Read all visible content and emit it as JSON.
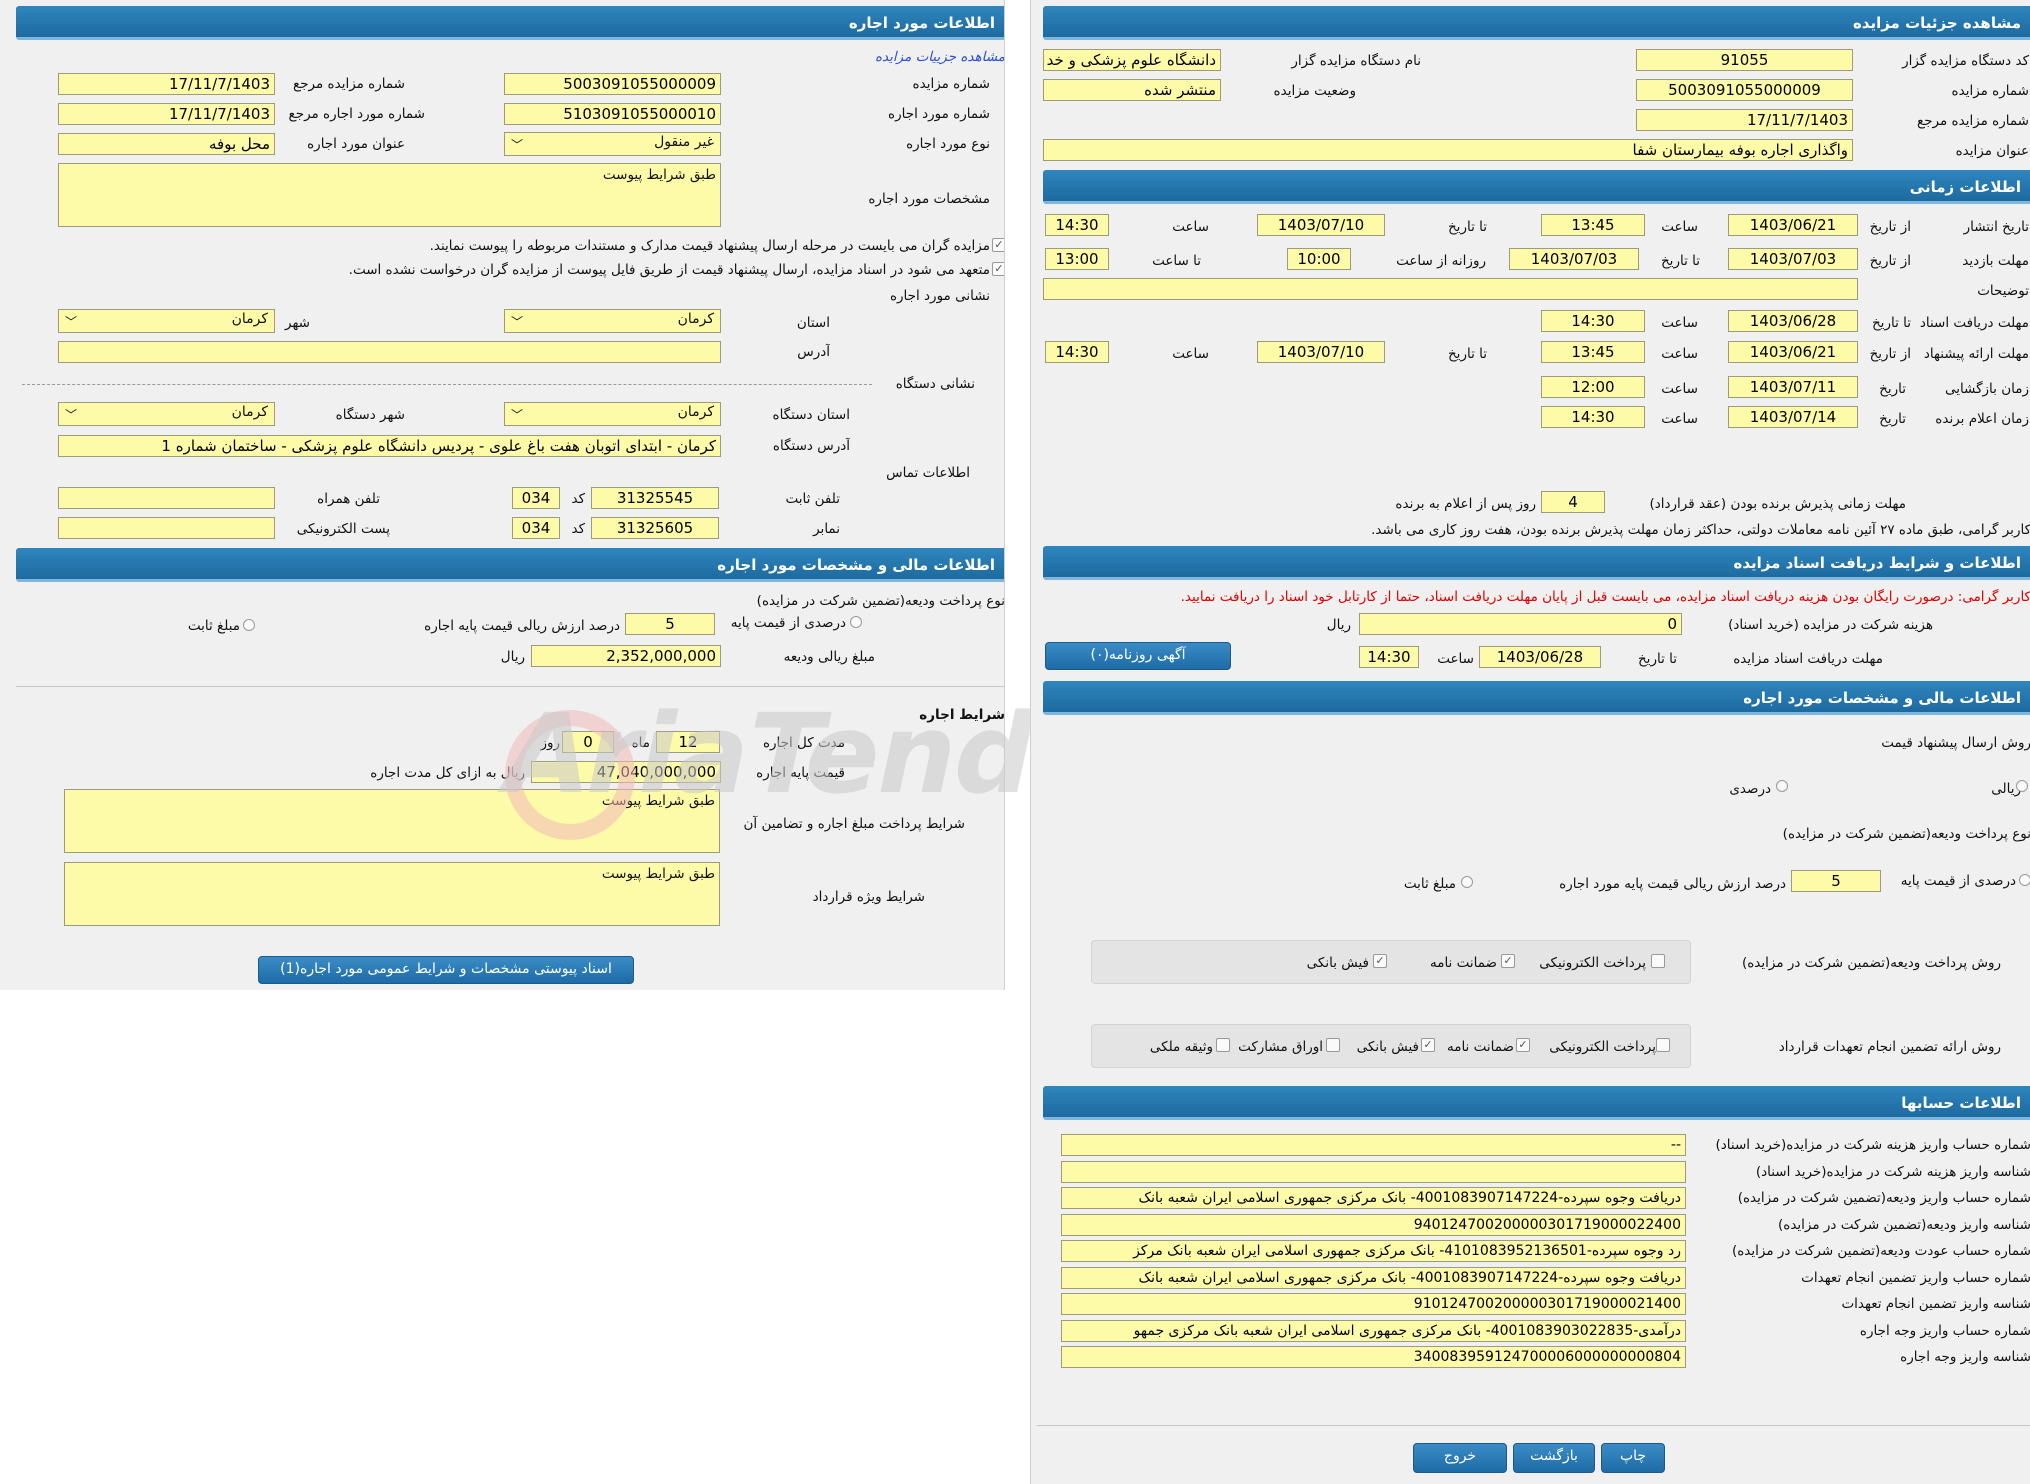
{
  "left": {
    "header": "اطلاعات مورد اجاره",
    "view_link": "مشاهده جزییات مزایده",
    "f": {
      "auction_no": "شماره مزایده",
      "auction_no_v": "5003091055000009",
      "ref_no": "شماره مزایده مرجع",
      "ref_no_v": "17/11/7/1403",
      "item_no": "شماره مورد اجاره",
      "item_no_v": "5103091055000010",
      "item_ref": "شماره مورد اجاره مرجع",
      "item_ref_v": "17/11/7/1403",
      "type": "نوع مورد اجاره",
      "type_v": "غیر منقول",
      "title": "عنوان مورد اجاره",
      "title_v": "محل بوفه",
      "spec": "مشخصات مورد اجاره",
      "spec_v": "طبق شرایط پیوست"
    },
    "chk1": "مزایده گران می بایست در مرحله ارسال پیشنهاد قیمت مدارک و مستندات مربوطه را پیوست نمایند.",
    "chk2": "متعهد می شود در اسناد مزایده، ارسال پیشنهاد قیمت از طریق فایل پیوست از مزایده گران درخواست نشده است.",
    "addr_sec": "نشانی مورد اجاره",
    "province": "استان",
    "province_v": "کرمان",
    "city": "شهر",
    "city_v": "کرمان",
    "address": "آدرس",
    "address_v": "",
    "dev_sec": "نشانی دستگاه",
    "dev_province": "استان دستگاه",
    "dev_province_v": "کرمان",
    "dev_city": "شهر دستگاه",
    "dev_city_v": "کرمان",
    "dev_addr": "آدرس دستگاه",
    "dev_addr_v": "کرمان - ابتدای اتوبان هفت باغ علوی - پردیس دانشگاه علوم پزشکی - ساختمان شماره 1",
    "contact_sec": "اطلاعات تماس",
    "phone": "تلفن ثابت",
    "phone_v": "31325545",
    "code": "کد",
    "code_v": "034",
    "mobile": "تلفن همراه",
    "mobile_v": "",
    "fax": "نمابر",
    "fax_v": "31325605",
    "email": "پست الکترونیکی",
    "email_v": "",
    "fin_header": "اطلاعات مالی و مشخصات مورد اجاره",
    "dep_type": "نوع پرداخت ودیعه(تضمین شرکت در مزایده)",
    "pct_base": "درصدی از قیمت پایه",
    "pct_v": "5",
    "pct_desc": "درصد ارزش ریالی قیمت پایه اجاره",
    "fixed": "مبلغ ثابت",
    "dep_amount": "مبلغ ریالی ودیعه",
    "dep_amount_v": "2,352,000,000",
    "rial": "ریال",
    "lease_sec": "شرایط اجاره",
    "duration": "مدت کل اجاره",
    "dur_month_v": "12",
    "month": "ماه",
    "dur_day_v": "0",
    "day": "روز",
    "base_price": "قیمت پایه اجاره",
    "base_price_v": "47,040,000,000",
    "base_price_unit": "ریال به ازای کل مدت اجاره",
    "pay_terms": "شرایط پرداخت مبلغ اجاره و تضامین آن",
    "pay_terms_v": "طبق شرایط پیوست",
    "special": "شرایط ویژه قرارداد",
    "special_v": "طبق شرایط پیوست",
    "docs_btn": "اسناد پیوستی مشخصات و شرایط عمومی مورد اجاره(1)"
  },
  "right": {
    "header": "مشاهده جزئیات مزایده",
    "f": {
      "org_code": "کد دستگاه مزایده گزار",
      "org_code_v": "91055",
      "org_name": "نام دستگاه مزایده گزار",
      "org_name_v": "دانشگاه علوم پزشکی و خد",
      "auction_no": "شماره مزایده",
      "auction_no_v": "5003091055000009",
      "status": "وضعیت مزایده",
      "status_v": "منتشر شده",
      "ref_no": "شماره مزایده مرجع",
      "ref_no_v": "17/11/7/1403",
      "title": "عنوان مزایده",
      "title_v": "واگذاری اجاره بوفه بیمارستان شفا"
    },
    "time_header": "اطلاعات زمانی",
    "t": {
      "pub": "تاریخ انتشار",
      "from_date": "از تاریخ",
      "to_date": "تا تاریخ",
      "hour": "ساعت",
      "to_hour": "تا ساعت",
      "daily_from": "روزانه از ساعت",
      "date": "تاریخ",
      "pub_from": "1403/06/21",
      "pub_from_h": "13:45",
      "pub_to": "1403/07/10",
      "pub_to_h": "14:30",
      "visit": "مهلت بازدید",
      "visit_from": "1403/07/03",
      "visit_to": "1403/07/03",
      "visit_daily": "10:00",
      "visit_to_h": "13:00",
      "notes": "توضیحات",
      "notes_v": "",
      "doc": "مهلت دریافت اسناد",
      "doc_to": "1403/06/28",
      "doc_to_h": "14:30",
      "offer": "مهلت ارائه پیشنهاد",
      "offer_from": "1403/06/21",
      "offer_from_h": "13:45",
      "offer_to": "1403/07/10",
      "offer_to_h": "14:30",
      "open": "زمان بازگشایی",
      "open_d": "1403/07/11",
      "open_h": "12:00",
      "win": "زمان اعلام برنده",
      "win_d": "1403/07/14",
      "win_h": "14:30"
    },
    "accept": "مهلت زمانی پذیرش برنده بودن (عقد قرارداد)",
    "accept_v": "4",
    "accept_unit": "روز پس از اعلام به برنده",
    "note27": "کاربر گرامی، طبق ماده ۲۷ آئین نامه معاملات دولتی، حداکثر زمان مهلت پذیرش برنده بودن، هفت روز کاری می باشد.",
    "docs_header": "اطلاعات و شرایط دریافت اسناد مزایده",
    "free_note": "کاربر گرامی: درصورت رایگان بودن هزینه دریافت اسناد مزایده، می بایست قبل از پایان مهلت دریافت اسناد، حتما از کارتابل خود اسناد را دریافت نمایید.",
    "fee": "هزینه شرکت در مزایده (خرید اسناد)",
    "fee_v": "0",
    "rial": "ریال",
    "doc_deadline": "مهلت دریافت اسناد مزایده",
    "to_date": "تا تاریخ",
    "dd_date": "1403/06/28",
    "hour": "ساعت",
    "dd_hour": "14:30",
    "ad_btn": "آگهی روزنامه(۰)",
    "fin_header": "اطلاعات مالی و مشخصات مورد اجاره",
    "send_method": "روش ارسال پیشنهاد قیمت",
    "rial_opt": "ریالی",
    "pct_opt": "درصدی",
    "dep_type": "نوع پرداخت ودیعه(تضمین شرکت در مزایده)",
    "pct_base": "درصدی از قیمت پایه",
    "pct_v": "5",
    "pct_desc": "درصد ارزش ریالی قیمت پایه مورد اجاره",
    "fixed": "مبلغ ثابت",
    "dep_method": "روش پرداخت ودیعه(تضمین شرکت در مزایده)",
    "epay": "پرداخت الکترونیکی",
    "guarantee": "ضمانت نامه",
    "receipt": "فیش بانکی",
    "contract_method": "روش ارائه تضمین انجام تعهدات قرارداد",
    "shares": "اوراق مشارکت",
    "property": "وثیقه ملکی",
    "acc_header": "اطلاعات حسابها",
    "acc": [
      {
        "label": "شماره حساب واریز هزینه شرکت در مزایده(خرید اسناد)",
        "value": "--"
      },
      {
        "label": "شناسه واریز هزینه شرکت در مزایده(خرید اسناد)",
        "value": ""
      },
      {
        "label": "شماره حساب واریز ودیعه(تضمین شرکت در مزایده)",
        "value": "دریافت وجوه سپرده-4001083907147224- بانک مرکزی جمهوری اسلامی ایران شعبه بانک"
      },
      {
        "label": "شناسه واریز ودیعه(تضمین شرکت در مزایده)",
        "value": "940124700200000301719000022400"
      },
      {
        "label": "شماره حساب عودت ودیعه(تضمین شرکت در مزایده)",
        "value": "رد وجوه سپرده-4101083952136501- بانک مرکزی جمهوری اسلامی ایران شعبه بانک مرکز"
      },
      {
        "label": "شماره حساب واریز تضمین انجام تعهدات",
        "value": "دریافت وجوه سپرده-4001083907147224- بانک مرکزی جمهوری اسلامی ایران شعبه بانک"
      },
      {
        "label": "شناسه واریز تضمین انجام تعهدات",
        "value": "910124700200000301719000021400"
      },
      {
        "label": "شماره حساب واریز وجه اجاره",
        "value": "درآمدی-4001083903022835- بانک مرکزی جمهوری اسلامی ایران شعبه بانک مرکزی جمهو"
      },
      {
        "label": "شناسه واریز وجه اجاره",
        "value": "340083959124700006000000000804"
      }
    ],
    "print_btn": "چاپ",
    "back_btn": "بازگشت",
    "exit_btn": "خروج"
  },
  "watermark": "AriaTender.neT"
}
